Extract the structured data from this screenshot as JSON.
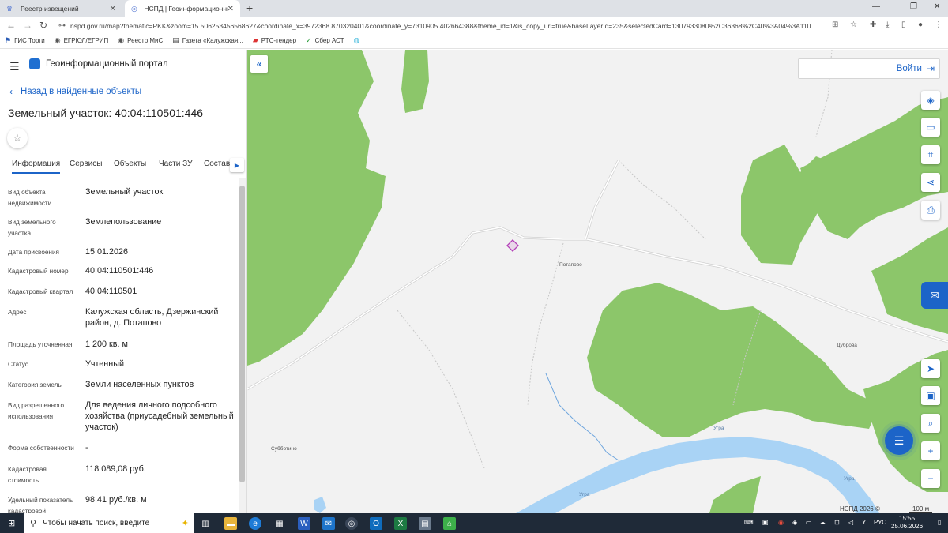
{
  "browser": {
    "tabs": [
      {
        "title": "Реестр извещений",
        "active": false
      },
      {
        "title": "НСПД | Геоинформационный п",
        "active": true
      }
    ],
    "url": "nspd.gov.ru/map?thematic=PKK&zoom=15.506253456568627&coordinate_x=3972368.870320401&coordinate_y=7310905.402664388&theme_id=1&is_copy_url=true&baseLayerId=235&selectedCard=1307933080%2C36368%2C40%3A04%3A110...",
    "bookmarks": [
      "ГИС Торги",
      "ЕГРЮЛ/ЕГРИП",
      "Реестр МиС",
      "Газета «Калужская...",
      "РТС-тендер",
      "Сбер АСТ"
    ]
  },
  "portal": {
    "title": "Геоинформационный портал",
    "back_label": "Назад в найденные объекты",
    "object_title": "Земельный участок: 40:04:110501:446",
    "tabs": [
      "Информация",
      "Сервисы",
      "Объекты",
      "Части ЗУ",
      "Состав"
    ],
    "fields": [
      {
        "label": "Вид объекта недвижимости",
        "value": "Земельный участок"
      },
      {
        "label": "Вид земельного участка",
        "value": "Землепользование"
      },
      {
        "label": "Дата присвоения",
        "value": "15.01.2026"
      },
      {
        "label": "Кадастровый номер",
        "value": "40:04:110501:446"
      },
      {
        "label": "Кадастровый квартал",
        "value": "40:04:110501"
      },
      {
        "label": "Адрес",
        "value": "Калужская область, Дзержинский район, д. Потапово"
      },
      {
        "label": "Площадь уточненная",
        "value": "1 200 кв. м"
      },
      {
        "label": "Статус",
        "value": "Учтенный"
      },
      {
        "label": "Категория земель",
        "value": "Земли населенных пунктов"
      },
      {
        "label": "Вид разрешенного использования",
        "value": "Для ведения личного подсобного хозяйства (приусадебный земельный участок)"
      },
      {
        "label": "Форма собственности",
        "value": "-"
      },
      {
        "label": "Кадастровая стоимость",
        "value": "118 089,08 руб."
      },
      {
        "label": "Удельный показатель кадастровой",
        "value": "98,41 руб./кв. м"
      }
    ]
  },
  "map": {
    "login_label": "Войти",
    "places": [
      "Потапово",
      "Дуброва",
      "Субботино",
      "Угра",
      "Угра",
      "Угра"
    ],
    "copyright": "НСПД 2026 ©",
    "scale": "100 м",
    "colors": {
      "forest": "#8cc66a",
      "water": "#a9d3f5",
      "background": "#f2f2f2",
      "parcel": "#b33fb8",
      "accent": "#1c64c8"
    }
  },
  "taskbar": {
    "search_placeholder": "Чтобы начать поиск, введите",
    "lang": "РУС",
    "time": "15:55",
    "date": "25.06.2026"
  }
}
